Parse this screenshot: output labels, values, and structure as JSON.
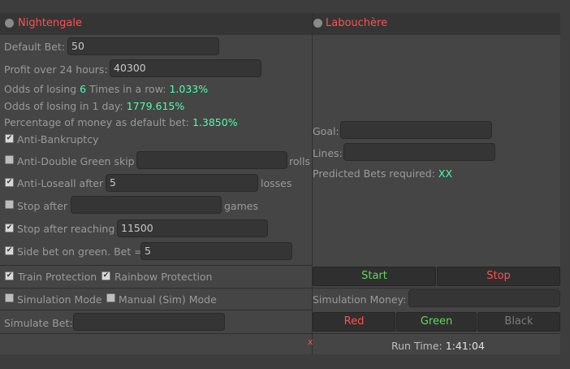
{
  "left_panel": {
    "title": "Nightengale",
    "default_bet": {
      "label": "Default Bet:",
      "value": "50"
    },
    "profit_24h": {
      "label": "Profit over 24 hours:",
      "value": "40300"
    },
    "odds_row": {
      "prefix": "Odds of losing",
      "count": "6",
      "suffix": "Times in a row:",
      "value": "1.033%"
    },
    "odds_day": {
      "label": "Odds of losing in 1 day:",
      "value": "1779.615%"
    },
    "pct_money": {
      "label": "Percentage of money as default bet:",
      "value": "1.3850%"
    },
    "anti_bankruptcy": {
      "label": "Anti-Bankruptcy",
      "checked": true
    },
    "anti_double": {
      "label": "Anti-Double Green skip",
      "value": "",
      "suffix": "rolls",
      "checked": false
    },
    "anti_loseall": {
      "label": "Anti-Loseall after",
      "value": "5",
      "suffix": "losses",
      "checked": true
    },
    "stop_after": {
      "label": "Stop after",
      "value": "",
      "suffix": "games",
      "checked": false
    },
    "stop_reaching": {
      "label": "Stop after reaching",
      "value": "11500",
      "checked": true
    },
    "side_bet": {
      "label": "Side bet on green. Bet =",
      "value": "5",
      "checked": true
    },
    "train_protection": {
      "label": "Train Protection",
      "checked": true
    },
    "rainbow_protection": {
      "label": "Rainbow Protection",
      "checked": true
    },
    "simulation_mode": {
      "label": "Simulation Mode",
      "checked": false
    },
    "manual_sim_mode": {
      "label": "Manual (Sim) Mode",
      "checked": false
    },
    "simulate_bet": {
      "label": "Simulate Bet:",
      "value": ""
    },
    "close_mark": "x"
  },
  "right_panel": {
    "title": "Labouchère",
    "goal": {
      "label": "Goal:",
      "value": ""
    },
    "lines": {
      "label": "Lines:",
      "value": ""
    },
    "predicted": {
      "label": "Predicted Bets required:",
      "value": "XX"
    },
    "start_label": "Start",
    "stop_label": "Stop",
    "simulation_money": {
      "label": "Simulation Money:",
      "value": ""
    },
    "red_label": "Red",
    "green_label": "Green",
    "black_label": "Black",
    "run_time": {
      "label": "Run Time:",
      "value": "1:41:04"
    }
  },
  "colors": {
    "accent_red": "#ff5050",
    "value_green": "#4dffb0",
    "button_green": "#5fd85f",
    "button_red": "#ff5050",
    "button_black_disabled": "#7a7a7a"
  }
}
